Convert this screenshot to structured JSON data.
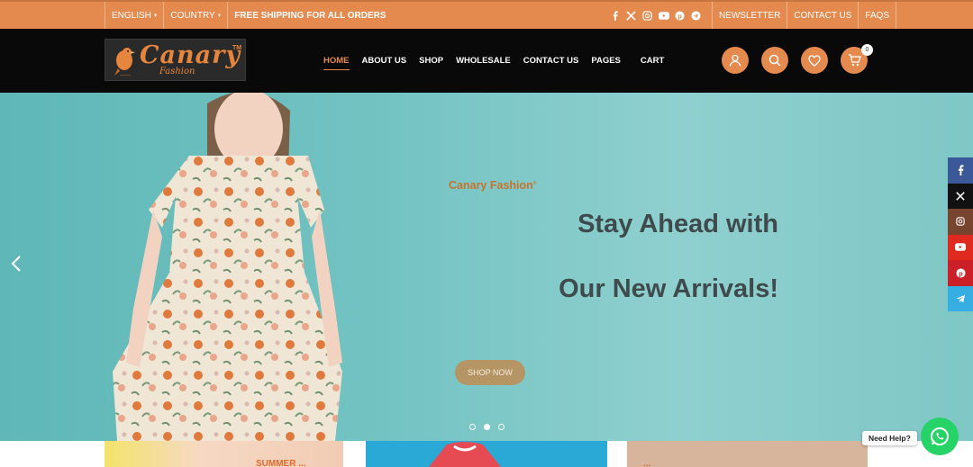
{
  "topbar": {
    "language": "ENGLISH",
    "country": "COUNTRY",
    "shipping": "FREE SHIPPING FOR ALL ORDERS",
    "social_icons": [
      "facebook-icon",
      "x-icon",
      "instagram-icon",
      "youtube-icon",
      "pinterest-icon",
      "telegram-icon"
    ],
    "links": [
      "NEWSLETTER",
      "CONTACT US",
      "FAQS"
    ]
  },
  "header": {
    "logo": {
      "name": "Canary",
      "sub": "Fashion",
      "tm": "TM"
    },
    "nav": [
      "HOME",
      "ABOUT US",
      "SHOP",
      "WHOLESALE",
      "CONTACT US",
      "PAGES",
      "CART"
    ],
    "active_nav": "HOME",
    "icons": [
      "user-icon",
      "search-icon",
      "heart-icon",
      "cart-icon"
    ],
    "cart_count": "0"
  },
  "hero": {
    "brand": "Canary Fashion",
    "headline_1": "Stay Ahead with",
    "headline_2": "Our New Arrivals!",
    "cta": "SHOP NOW",
    "slides": 3,
    "active_slide": 2
  },
  "side_social": [
    "facebook-icon",
    "x-icon",
    "instagram-icon",
    "youtube-icon",
    "pinterest-icon",
    "telegram-icon"
  ],
  "cards": {
    "card1_label": "SUMMER ...",
    "card3_label": "..."
  },
  "help": {
    "label": "Need Help?"
  },
  "colors": {
    "accent": "#e58a4f",
    "header_bg": "#090909",
    "hero_bg": "#74c3c3"
  }
}
